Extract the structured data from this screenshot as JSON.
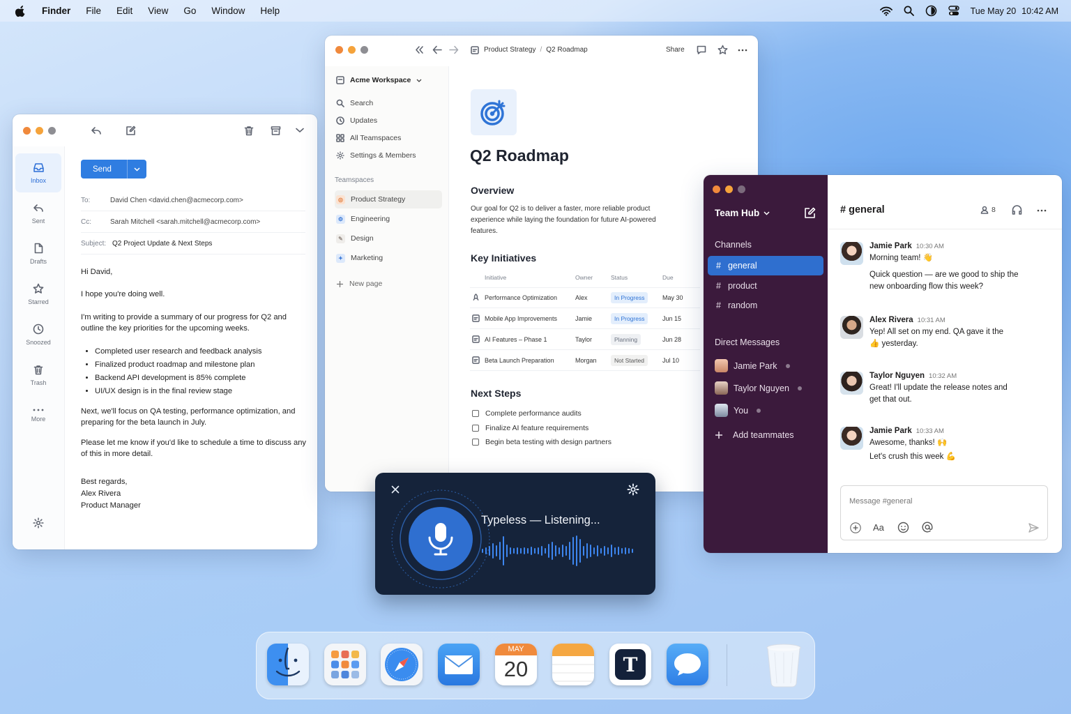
{
  "menubar": {
    "app": "Finder",
    "items": [
      "File",
      "Edit",
      "View",
      "Go",
      "Window",
      "Help"
    ],
    "date": "Tue May 20",
    "time": "10:42 AM"
  },
  "mail": {
    "send_label": "Send",
    "sidebar": [
      {
        "label": "Inbox"
      },
      {
        "label": "Sent"
      },
      {
        "label": "Drafts"
      },
      {
        "label": "Starred"
      },
      {
        "label": "Snoozed"
      },
      {
        "label": "Trash"
      },
      {
        "label": "More"
      }
    ],
    "to_label": "To:",
    "to": "David Chen <david.chen@acmecorp.com>",
    "cc_label": "Cc:",
    "cc": "Sarah Mitchell <sarah.mitchell@acmecorp.com>",
    "subject_label": "Subject:",
    "subject": "Q2 Project Update & Next Steps",
    "greeting": "Hi David,",
    "p1": "I hope you're doing well.",
    "p2": "I'm writing to provide a summary of our progress for Q2 and outline the key priorities for the upcoming weeks.",
    "bullets": [
      "Completed user research and feedback analysis",
      "Finalized product roadmap and milestone plan",
      "Backend API development is 85% complete",
      "UI/UX design is in the final review stage"
    ],
    "p3": "Next, we'll focus on QA testing, performance optimization, and preparing for the beta launch in July.",
    "p4": "Please let me know if you'd like to schedule a time to discuss any of this in more detail.",
    "signoff": "Best regards,",
    "name": "Alex Rivera",
    "role": "Product Manager"
  },
  "notion": {
    "breadcrumb": [
      "Product Strategy",
      "/",
      "Q2 Roadmap"
    ],
    "share": "Share",
    "workspace": "Acme Workspace",
    "nav": [
      "Search",
      "Updates",
      "All Teamspaces",
      "Settings & Members"
    ],
    "teamspaces_label": "Teamspaces",
    "teamspaces": [
      {
        "label": "Product Strategy",
        "color": "#f4b38a"
      },
      {
        "label": "Engineering",
        "color": "#8db8f2"
      },
      {
        "label": "Design",
        "color": "#c9c3bd"
      },
      {
        "label": "Marketing",
        "color": "#8db8f2"
      }
    ],
    "new_page": "New page",
    "title": "Q2 Roadmap",
    "overview_h": "Overview",
    "overview": "Our goal for Q2 is to deliver a faster, more reliable product experience while laying the foundation for future AI-powered features.",
    "initiatives_h": "Key Initiatives",
    "table_headers": [
      "Initiative",
      "Owner",
      "Status",
      "Due"
    ],
    "rows": [
      {
        "name": "Performance Optimization",
        "owner": "Alex",
        "status": "In Progress",
        "due": "May 30"
      },
      {
        "name": "Mobile App Improvements",
        "owner": "Jamie",
        "status": "In Progress",
        "due": "Jun 15"
      },
      {
        "name": "AI Features – Phase 1",
        "owner": "Taylor",
        "status": "Planning",
        "due": "Jun 28"
      },
      {
        "name": "Beta Launch Preparation",
        "owner": "Morgan",
        "status": "Not Started",
        "due": "Jul 10"
      }
    ],
    "next_h": "Next Steps",
    "next": [
      "Complete performance audits",
      "Finalize AI feature requirements",
      "Begin beta testing with design partners"
    ]
  },
  "slack": {
    "workspace": "Team Hub",
    "channels_label": "Channels",
    "channels": [
      "general",
      "product",
      "random"
    ],
    "dm_label": "Direct Messages",
    "dms": [
      "Jamie Park",
      "Taylor Nguyen",
      "You"
    ],
    "add": "Add teammates",
    "channel_title": "# general",
    "members": "8",
    "messages": [
      {
        "name": "Jamie Park",
        "time": "10:30 AM",
        "lines": [
          "Morning team! 👋",
          "Quick question — are we good to ship the new onboarding flow this week?"
        ]
      },
      {
        "name": "Alex Rivera",
        "time": "10:31 AM",
        "lines": [
          "Yep! All set on my end. QA gave it the 👍 yesterday."
        ]
      },
      {
        "name": "Taylor Nguyen",
        "time": "10:32 AM",
        "lines": [
          "Great! I'll update the release notes and get that out."
        ]
      },
      {
        "name": "Jamie Park",
        "time": "10:33 AM",
        "lines": [
          "Awesome, thanks! 🙌",
          "Let's crush this week 💪"
        ]
      }
    ],
    "placeholder": "Message #general",
    "format": "Aa"
  },
  "voice": {
    "status": "Typeless — Listening..."
  },
  "dock": {
    "calendar_month": "MAY",
    "calendar_day": "20",
    "typeless_letter": "T"
  }
}
